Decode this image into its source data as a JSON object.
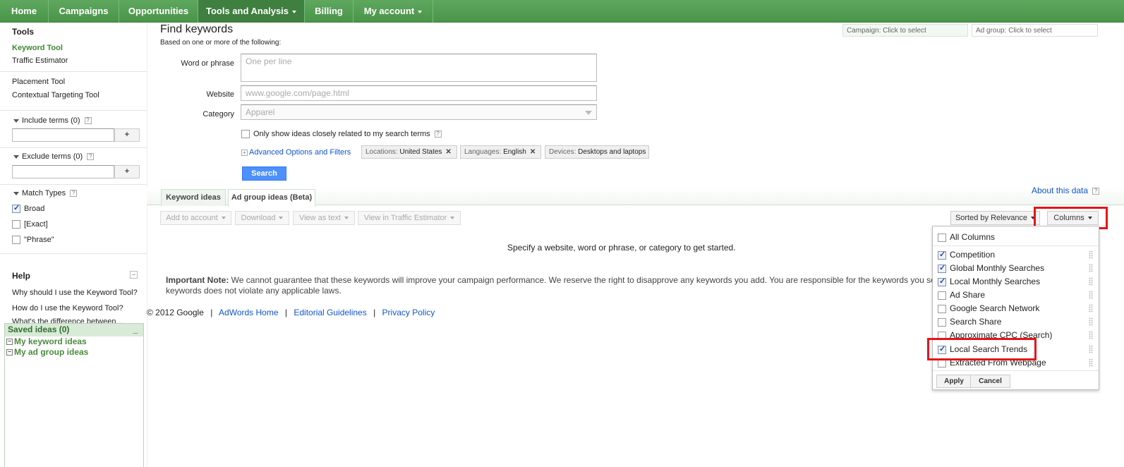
{
  "topnav": {
    "items": [
      {
        "label": "Home"
      },
      {
        "label": "Campaigns"
      },
      {
        "label": "Opportunities"
      },
      {
        "label": "Tools and Analysis"
      },
      {
        "label": "Billing"
      },
      {
        "label": "My account"
      }
    ],
    "active": "Tools and Analysis"
  },
  "sidebar": {
    "title": "Tools",
    "tools": [
      "Keyword Tool",
      "Traffic Estimator",
      "Placement Tool",
      "Contextual Targeting Tool"
    ],
    "include_terms": "Include terms (0)",
    "exclude_terms": "Exclude terms (0)",
    "plus": "+",
    "help_mark": "?",
    "match_types": {
      "label": "Match Types",
      "options": [
        {
          "label": "Broad",
          "checked": true
        },
        {
          "label": "[Exact]",
          "checked": false
        },
        {
          "label": "\"Phrase\"",
          "checked": false
        }
      ]
    },
    "help": {
      "title": "Help",
      "minus": "−",
      "links": [
        "Why should I use the Keyword Tool?",
        "How do I use the Keyword Tool?",
        "What's the difference between..."
      ]
    },
    "saved": {
      "title": "Saved ideas (0)",
      "minimize": "_",
      "items": [
        "My keyword ideas",
        "My ad group ideas"
      ]
    }
  },
  "selectors": {
    "campaign": "Campaign: Click to select",
    "adgroup": "Ad group: Click to select"
  },
  "find": {
    "title": "Find keywords",
    "subtitle": "Based on one or more of the following:",
    "word_label": "Word or phrase",
    "word_placeholder": "One per line",
    "website_label": "Website",
    "website_placeholder": "www.google.com/page.html",
    "category_label": "Category",
    "category_value": "Apparel",
    "only_show": "Only show ideas closely related to my search terms",
    "advanced": "Advanced Options and Filters",
    "filters": [
      {
        "key": "Locations:",
        "value": "United States",
        "removable": true
      },
      {
        "key": "Languages:",
        "value": "English",
        "removable": true
      },
      {
        "key": "Devices:",
        "value": "Desktops and laptops",
        "removable": false
      }
    ],
    "search_button": "Search"
  },
  "results": {
    "tabs": [
      "Keyword ideas",
      "Ad group ideas (Beta)"
    ],
    "active_tab": "Ad group ideas (Beta)",
    "about": "About this data",
    "toolbar": [
      "Add to account",
      "Download",
      "View as text",
      "View in Traffic Estimator"
    ],
    "sorted": "Sorted by Relevance",
    "columns": "Columns",
    "empty_message": "Specify a website, word or phrase, or category to get started.",
    "note_bold": "Important Note:",
    "note_line1": "We cannot guarantee that these keywords will improve your campaign performance. We reserve the right to disapprove any keywords you add. You are responsible for the keywords you se",
    "note_line2": "keywords does not violate any applicable laws."
  },
  "columns_dropdown": {
    "all": {
      "label": "All Columns",
      "checked": false
    },
    "items": [
      {
        "label": "Competition",
        "checked": true
      },
      {
        "label": "Global Monthly Searches",
        "checked": true
      },
      {
        "label": "Local Monthly Searches",
        "checked": true
      },
      {
        "label": "Ad Share",
        "checked": false
      },
      {
        "label": "Google Search Network",
        "checked": false
      },
      {
        "label": "Search Share",
        "checked": false
      },
      {
        "label": "Approximate CPC (Search)",
        "checked": false
      },
      {
        "label": "Local Search Trends",
        "checked": true
      },
      {
        "label": "Extracted From Webpage",
        "checked": false
      }
    ],
    "apply": "Apply",
    "cancel": "Cancel"
  },
  "footer": {
    "copyright": "© 2012 Google",
    "sep": "|",
    "links": [
      "AdWords Home",
      "Editorial Guidelines",
      "Privacy Policy"
    ]
  }
}
